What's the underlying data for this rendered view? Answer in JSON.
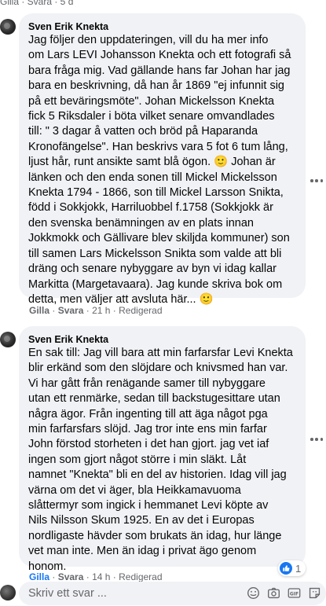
{
  "top_partial_actions": "Gilla · Svara · 5 d",
  "comments": [
    {
      "author": "Sven Erik Knekta",
      "text": "Jag följer den uppdateringen, vill du ha mer info\nom Lars LEVI Johansson Knekta och ett fotografi så\nbara fråga mig. Vad gällande hans far Johan har jag\nbara en beskrivning, då han år 1869 \"ej infunnit sig\npå ett beväringsmöte\". Johan Mickelsson Knekta\nfick 5 Riksdaler i böta vilket senare omvandlades\ntill: \" 3 dagar å vatten och bröd på Haparanda\nKronofängelse\". Han beskrivs vara 5 fot 6 tum lång,\nljust hår, runt ansikte samt blå ögon. 🙂 Johan är\nlänken och den enda sonen till Mickel Mickelsson\nKnekta 1794 - 1866, son till Mickel Larsson Snikta,\nfödd i Sokkjokk, Harriluobbel f.1758 (Sokkjokk är\nden svenska benämningen av en plats innan\nJokkmokk och Gällivare blev skiljda kommuner) son\ntill samen Lars Mickelsson Snikta som valde att bli\ndräng och senare nybyggare av byn vi idag kallar\nMarkitta (Margetavaara). Jag kunde skriva bok om\ndetta, men väljer att avsluta här... 🙂",
      "actions": {
        "like": "Gilla",
        "reply": "Svara",
        "time": "21 h",
        "edited": "Redigerad"
      }
    },
    {
      "author": "Sven Erik Knekta",
      "text": "En sak till: Jag vill bara att min farfarsfar Levi Knekta\nblir erkänd som den slöjdare och knivsmed han var.\nVi har gått från renägande samer till nybyggare\nutan ett renmärke, sedan till backstugesittare utan\nnågra ägor. Från ingenting till att äga något pga\nmin farfarsfars slöjd. Jag tror inte ens min farfar\nJohn förstod storheten i det han gjort. jag vet iaf\ningen som gjort något större i min släkt. Låt\nnamnet \"Knekta\" bli en del av historien. Idag vill jag\nvärna om det vi äger, bla Heikkamavuoma\nslåttermyr som ingick i hemmanet Levi köpte av\nNils Nilsson Skum 1925. En av det i Europas\nnordligaste hävder som brukats än idag, hur länge\nvet man inte. Men än idag i privat ägo genom\nhonom.",
      "actions": {
        "like": "Gilla",
        "reply": "Svara",
        "time": "14 h",
        "edited": "Redigerad"
      },
      "reaction_count": "1"
    }
  ],
  "composer": {
    "placeholder": "Skriv ett svar ..."
  },
  "icons": {
    "more": "more-options-icon",
    "like_reaction": "like-reaction-icon",
    "emoji": "emoji-icon",
    "camera": "camera-icon",
    "gif": "gif-icon",
    "sticker": "sticker-icon"
  },
  "colors": {
    "bubble_bg": "#f0f2f5",
    "secondary_text": "#65676b",
    "like_blue": "#1877f2"
  }
}
